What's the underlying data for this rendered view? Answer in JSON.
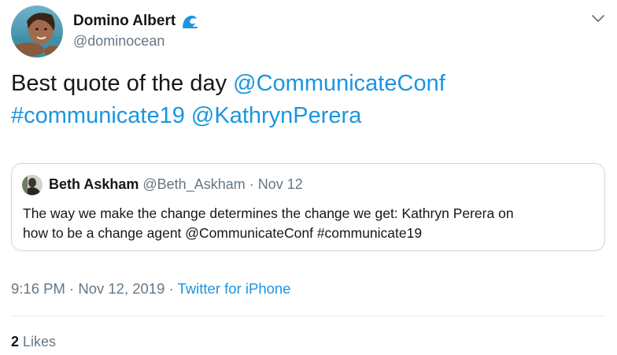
{
  "author": {
    "name": "Domino Albert",
    "handle": "@dominocean",
    "badge_icon": "wave-icon"
  },
  "tweet": {
    "text": "Best quote of the day",
    "mention_1": "@CommunicateConf",
    "hashtag": "#communicate19",
    "mention_2": "@KathrynPerera"
  },
  "quoted_tweet": {
    "name": "Beth Askham",
    "handle": "@Beth_Askham",
    "date": "· Nov 12",
    "text_line_1": "The way we make the change determines the change we get: Kathryn Perera on",
    "text_line_2": "how to be a change agent @CommunicateConf  #communicate19"
  },
  "meta": {
    "time": "9:16 PM · Nov 12, 2019 ·",
    "source": "Twitter for iPhone"
  },
  "stats": {
    "likes_count": "2",
    "likes_label": "Likes"
  },
  "colors": {
    "link": "#1b95e0",
    "secondary_text": "#657786",
    "primary_text": "#14171a",
    "border": "#ccd6dd"
  }
}
